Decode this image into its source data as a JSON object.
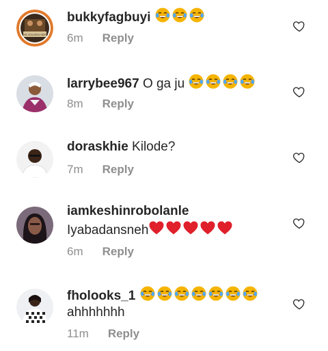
{
  "comments": [
    {
      "username": "bukkyfagbuyi",
      "text": "",
      "text_line2": "",
      "time": "6m",
      "reply_label": "Reply",
      "emoji_run": [
        "laugh-emoji",
        "laugh-emoji",
        "laugh-emoji"
      ],
      "emoji_color": "#f5b400",
      "avatar_logo_text": "THE GOLDEN SEED"
    },
    {
      "username": "larrybee967",
      "text": "O ga ju",
      "text_line2": "",
      "time": "8m",
      "reply_label": "Reply",
      "emoji_run": [
        "laugh-emoji",
        "laugh-emoji",
        "laugh-emoji",
        "laugh-emoji"
      ],
      "emoji_color": "#f5b400"
    },
    {
      "username": "doraskhie",
      "text": "Kilode?",
      "text_line2": "",
      "time": "7m",
      "reply_label": "Reply",
      "emoji_run": [],
      "emoji_color": "#f5b400"
    },
    {
      "username": "iamkeshinrobolanle",
      "text": "",
      "text_line2": "Iyabadansneh",
      "time": "6m",
      "reply_label": "Reply",
      "emoji_run": [
        "red-heart-emoji",
        "red-heart-emoji",
        "red-heart-emoji",
        "red-heart-emoji",
        "red-heart-emoji"
      ],
      "emoji_color": "#e0202b"
    },
    {
      "username": "fholooks_1",
      "text": "",
      "text_line2": "ahhhhhhh",
      "time": "11m",
      "reply_label": "Reply",
      "emoji_run": [
        "laugh-emoji",
        "laugh-emoji",
        "laugh-emoji",
        "laugh-emoji",
        "laugh-emoji",
        "laugh-emoji",
        "laugh-emoji"
      ],
      "emoji_color": "#f5b400"
    }
  ],
  "icons": {
    "like": "heart-outline-icon"
  }
}
